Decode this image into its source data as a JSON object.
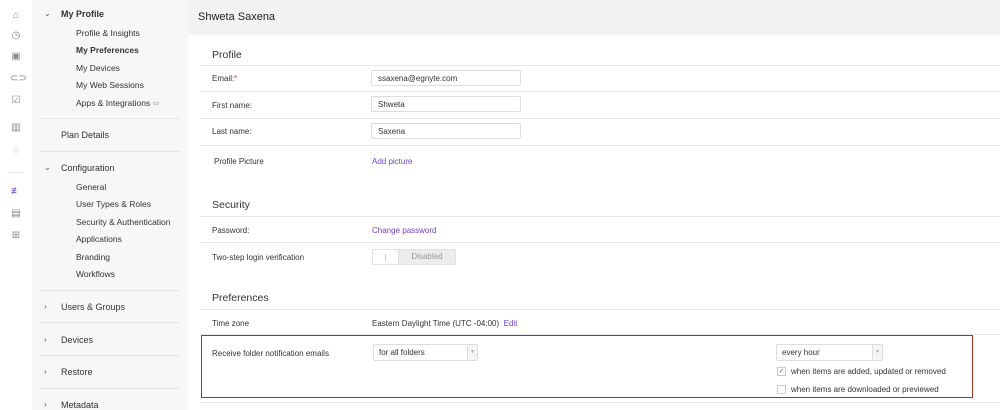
{
  "rail": {
    "icons": [
      "home-icon",
      "clock-icon",
      "file-icon",
      "link-icon",
      "clipboard-check-icon",
      "trash-icon",
      "shield-icon",
      "sliders-icon",
      "report-icon",
      "apps-icon"
    ]
  },
  "nav": {
    "my_profile": "My Profile",
    "my_profile_items": [
      "Profile & Insights",
      "My Preferences",
      "My Devices",
      "My Web Sessions",
      "Apps & Integrations"
    ],
    "plan_details": "Plan Details",
    "configuration": "Configuration",
    "configuration_items": [
      "General",
      "User Types & Roles",
      "Security & Authentication",
      "Applications",
      "Branding",
      "Workflows"
    ],
    "users_groups": "Users & Groups",
    "devices": "Devices",
    "restore": "Restore",
    "metadata": "Metadata"
  },
  "header": {
    "title": "Shweta Saxena"
  },
  "profile": {
    "title": "Profile",
    "email_label": "Email:",
    "required": "*",
    "email": "ssaxena@egnyte.com",
    "first_label": "First name:",
    "first": "Shweta",
    "last_label": "Last name:",
    "last": "Saxena",
    "picture_label": "Profile Picture",
    "add_picture": "Add picture"
  },
  "security": {
    "title": "Security",
    "password_label": "Password:",
    "change_password": "Change password",
    "twostep_label": "Two-step login verification",
    "twostep_state": "Disabled"
  },
  "preferences": {
    "title": "Preferences",
    "timezone_label": "Time zone",
    "timezone": "Eastern Daylight Time (UTC -04:00)",
    "edit": "Edit",
    "notif_label": "Receive folder notification emails",
    "folders_select": "for all folders",
    "frequency_select": "every hour",
    "cb1_label": "when items are added, updated or removed",
    "cb1_checked": true,
    "cb2_label": "when items are downloaded or previewed",
    "cb2_checked": false
  },
  "colors": {
    "accent": "#6a45c8",
    "highlight_box": "#a8321f"
  }
}
